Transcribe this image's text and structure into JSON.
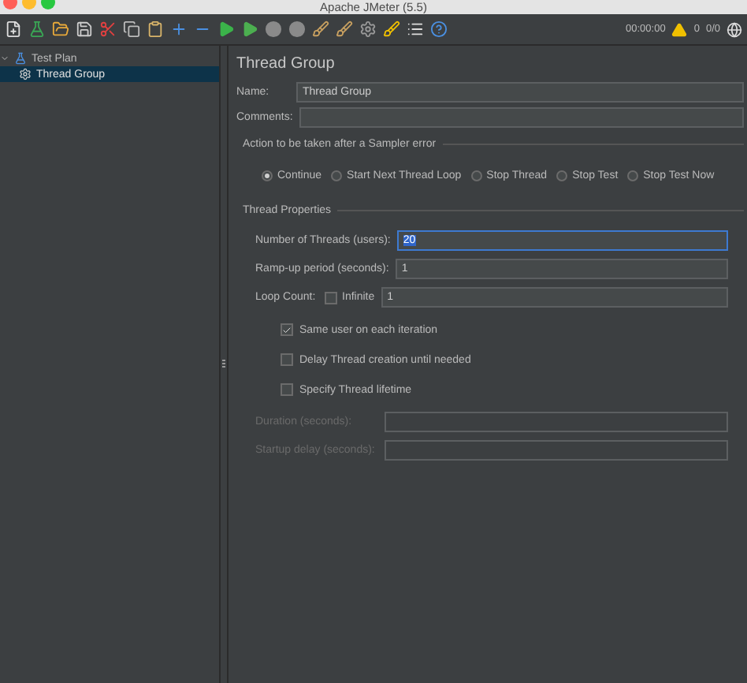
{
  "window": {
    "title": "Apache JMeter (5.5)"
  },
  "toolbar": {
    "timer": "00:00:00",
    "warnings": "0",
    "threads": "0/0"
  },
  "tree": [
    {
      "label": "Test Plan",
      "expanded": true,
      "selected": false,
      "children": [
        {
          "label": "Thread Group",
          "selected": true
        }
      ]
    }
  ],
  "panel": {
    "title": "Thread Group",
    "name": {
      "label": "Name:",
      "value": "Thread Group"
    },
    "comments": {
      "label": "Comments:"
    },
    "error_action": {
      "title": "Action to be taken after a Sampler error",
      "options": [
        {
          "label": "Continue",
          "selected": true
        },
        {
          "label": "Start Next Thread Loop",
          "selected": false
        },
        {
          "label": "Stop Thread",
          "selected": false
        },
        {
          "label": "Stop Test",
          "selected": false
        },
        {
          "label": "Stop Test Now",
          "selected": false
        }
      ]
    },
    "thread_properties": {
      "title": "Thread Properties",
      "fields": [
        {
          "label": "Number of Threads (users):",
          "value": "20",
          "focused": true
        },
        {
          "label": "Ramp-up period (seconds):",
          "value": "1",
          "focused": false
        }
      ],
      "loop": {
        "label": "Loop Count:",
        "infinite_label": "Infinite",
        "infinite_checked": false,
        "value": "1"
      },
      "checkboxes": [
        {
          "label": "Same user on each iteration",
          "checked": true
        },
        {
          "label": "Delay Thread creation until needed",
          "checked": false
        },
        {
          "label": "Specify Thread lifetime",
          "checked": false
        }
      ],
      "lifetime_fields": [
        {
          "label": "Duration (seconds):",
          "disabled": true
        },
        {
          "label": "Startup delay (seconds):",
          "disabled": true
        }
      ]
    }
  }
}
